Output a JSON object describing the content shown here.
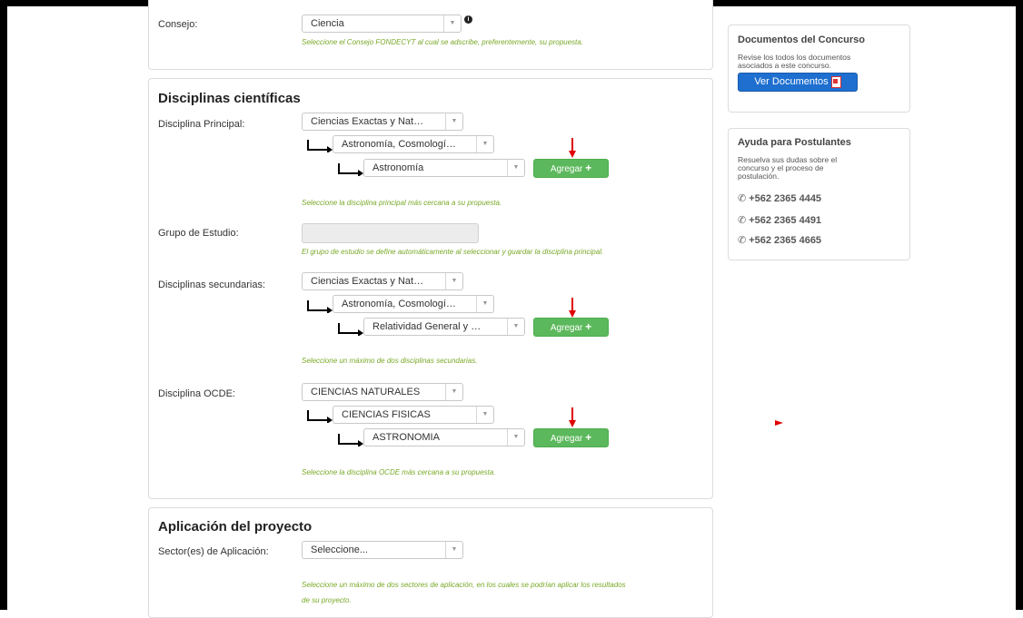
{
  "consejo": {
    "label": "Consejo:",
    "value": "Ciencia",
    "help": "Seleccione el Consejo FONDECYT al cual se adscribe, preferentemente, su propuesta."
  },
  "disciplinas": {
    "title": "Disciplinas científicas",
    "principal": {
      "label": "Disciplina Principal:",
      "level1": "Ciencias Exactas y Nat…",
      "level2": "Astronomía, Cosmologí…",
      "level3": "Astronomía",
      "add_label": "Agregar",
      "help": "Seleccione la disciplina principal más cercana a su propuesta."
    },
    "grupo": {
      "label": "Grupo de Estudio:",
      "value": "",
      "help": "El grupo de estudio se define automáticamente al seleccionar y guardar la disciplina principal."
    },
    "secundarias": {
      "label": "Disciplinas secundarias:",
      "level1": "Ciencias Exactas y Nat…",
      "level2": "Astronomía, Cosmologí…",
      "level3": "Relatividad General y …",
      "add_label": "Agregar",
      "help": "Seleccione un máximo de dos disciplinas secundarias."
    },
    "ocde": {
      "label": "Disciplina OCDE:",
      "level1": "CIENCIAS NATURALES",
      "level2": "CIENCIAS FISICAS",
      "level3": "ASTRONOMIA",
      "add_label": "Agregar",
      "help": "Seleccione la disciplina OCDE más cercana a su propuesta."
    }
  },
  "aplicacion": {
    "title": "Aplicación del proyecto",
    "label": "Sector(es) de Aplicación:",
    "value": "Seleccione...",
    "help_line1": "Seleccione un máximo de dos sectores de aplicación, en los cuales se podrían aplicar los resultados",
    "help_line2": "de su proyecto."
  },
  "sidebar": {
    "docs": {
      "title": "Documentos del Concurso",
      "text_line1": "Revise los todos los documentos",
      "text_line2": "asociados a este concurso.",
      "button": "Ver Documentos"
    },
    "ayuda": {
      "title": "Ayuda para Postulantes",
      "text_line1": "Resuelva sus dudas sobre el",
      "text_line2": "concurso y el proceso de",
      "text_line3": "postulación.",
      "phones": [
        "+562 2365 4445",
        "+562 2365 4491",
        "+562 2365 4665"
      ]
    }
  },
  "colors": {
    "help_text": "#79a928",
    "add_button": "#5cb85c",
    "docs_button": "#1e6fd0",
    "annotation_arrow": "#e00000"
  },
  "icons": {
    "info": "info-circle-icon",
    "dropdown": "caret-down-icon",
    "add": "plus-icon",
    "pdf": "pdf-icon",
    "phone": "phone-icon",
    "connector": "elbow-arrow-icon"
  }
}
